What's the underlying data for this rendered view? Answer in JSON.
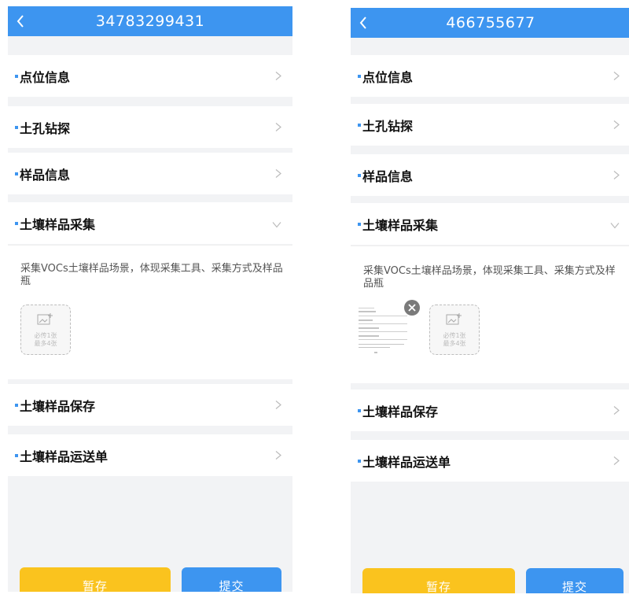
{
  "left_screen": {
    "header": {
      "title": "34783299431"
    },
    "sections": [
      {
        "label": "点位信息"
      },
      {
        "label": "土孔钻探"
      },
      {
        "label": "样品信息"
      },
      {
        "label": "土壤样品采集"
      },
      {
        "label": "土壤样品保存"
      },
      {
        "label": "土壤样品运送单"
      }
    ],
    "sample_collection": {
      "description": "采集VOCs土壤样品场景，体现采集工具、采集方式及样品瓶",
      "upload_hint_line1": "必传1张",
      "upload_hint_line2": "最多4张"
    },
    "buttons": {
      "save": "暂存",
      "submit": "提交"
    }
  },
  "right_screen": {
    "header": {
      "title": "466755677"
    },
    "sections": [
      {
        "label": "点位信息"
      },
      {
        "label": "土孔钻探"
      },
      {
        "label": "样品信息"
      },
      {
        "label": "土壤样品采集"
      },
      {
        "label": "土壤样品保存"
      },
      {
        "label": "土壤样品运送单"
      }
    ],
    "sample_collection": {
      "description": "采集VOCs土壤样品场景，体现采集工具、采集方式及样品瓶",
      "upload_hint_line1": "必传1张",
      "upload_hint_line2": "最多4张"
    },
    "buttons": {
      "save": "暂存",
      "submit": "提交"
    }
  },
  "colors": {
    "primary": "#3d95f0",
    "save": "#fac31e",
    "background": "#f2f3f5"
  }
}
